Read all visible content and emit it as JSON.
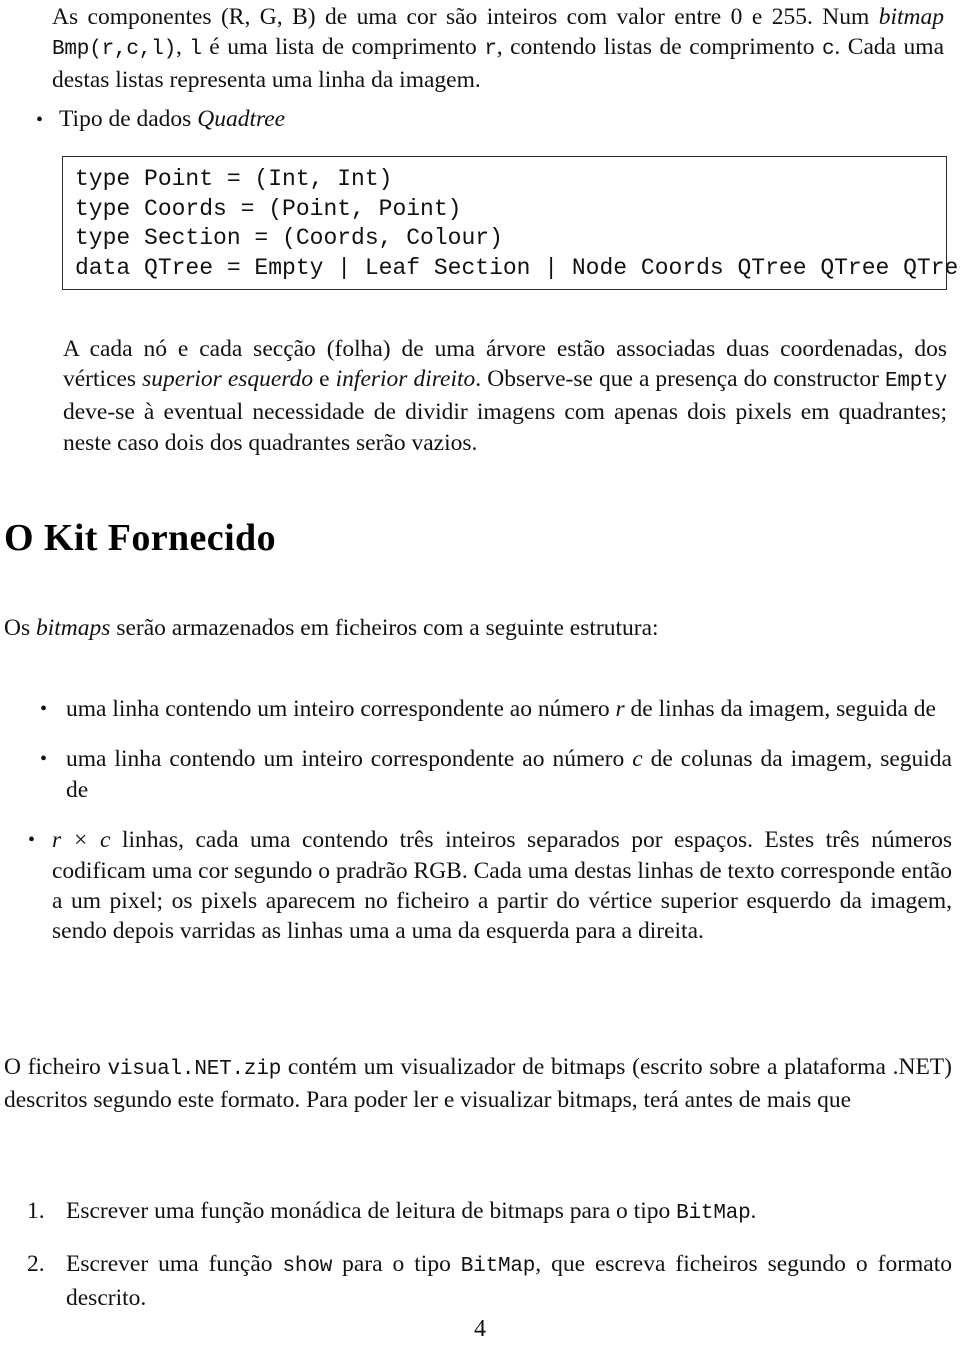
{
  "document": {
    "page_number": "4",
    "bullet_marker": "•"
  },
  "intro_paragraph": {
    "seg1": "As componentes (R, G, B) de uma cor são inteiros com valor entre 0 e 255. Num ",
    "bitmap_italic": "bitmap",
    "seg2": " ",
    "code_bmp": "Bmp(r,c,l)",
    "seg3": ", ",
    "code_l": "l",
    "seg4": " é uma lista de comprimento ",
    "code_r": "r",
    "seg5": ", contendo listas de comprimento ",
    "code_c": "c",
    "seg6": ". Cada uma destas listas representa uma linha da imagem."
  },
  "quadtree_bullet": {
    "prefix": "Tipo de dados ",
    "italic_term": "Quadtree"
  },
  "code_listing": {
    "lines": [
      "type Point = (Int, Int)",
      "type Coords = (Point, Point)",
      "type Section = (Coords, Colour)",
      "data QTree = Empty | Leaf Section | Node Coords QTree QTree QTree QTree"
    ]
  },
  "coords_paragraph": {
    "seg1": "A cada nó e cada secção (folha) de uma árvore estão associadas duas coordenadas, dos vértices ",
    "italic1": "superior esquerdo",
    "seg2": " e ",
    "italic2": "inferior direito",
    "seg3": ". Observe-se que a presença do constructor ",
    "code_empty": "Empty",
    "seg4": " deve-se à eventual necessidade de dividir imagens com apenas dois pixels em quadrantes; neste caso dois dos quadrantes serão vazios."
  },
  "section": {
    "heading": "O Kit Fornecido",
    "lead_seg1": "Os ",
    "lead_italic": "bitmaps",
    "lead_seg2": " serão armazenados em ficheiros com a seguinte estrutura:"
  },
  "structure_bullets": [
    {
      "seg1": "uma linha contendo um inteiro correspondente ao número ",
      "math": "r",
      "seg2": " de linhas da imagem, seguida de"
    },
    {
      "seg1": "uma linha contendo um inteiro correspondente ao número ",
      "math": "c",
      "seg2": " de colunas da imagem, seguida de"
    },
    {
      "math_lead": "r × c",
      "seg2": " linhas, cada uma contendo três inteiros separados por espaços. Estes três números codificam uma cor segundo o pradrão RGB. Cada uma destas linhas de texto corresponde então a um pixel; os pixels aparecem no ficheiro a partir do vértice superior esquerdo da imagem, sendo depois varridas as linhas uma a uma da esquerda para a direita."
    }
  ],
  "visual_paragraph": {
    "seg1": "O ficheiro ",
    "code_file": "visual.NET.zip",
    "seg2": " contém um visualizador de bitmaps (escrito sobre a plataforma .NET) descritos segundo este formato. Para poder ler e visualizar bitmaps, terá antes de mais que"
  },
  "numbered_tasks": [
    {
      "number": "1.",
      "seg1": "Escrever uma função monádica de leitura de bitmaps para o tipo ",
      "code1": "BitMap",
      "seg2": "."
    },
    {
      "number": "2.",
      "seg1": "Escrever uma função ",
      "code1": "show",
      "seg2": " para o tipo ",
      "code2": "BitMap",
      "seg3": ", que escreva ficheiros segundo o formato descrito."
    }
  ]
}
